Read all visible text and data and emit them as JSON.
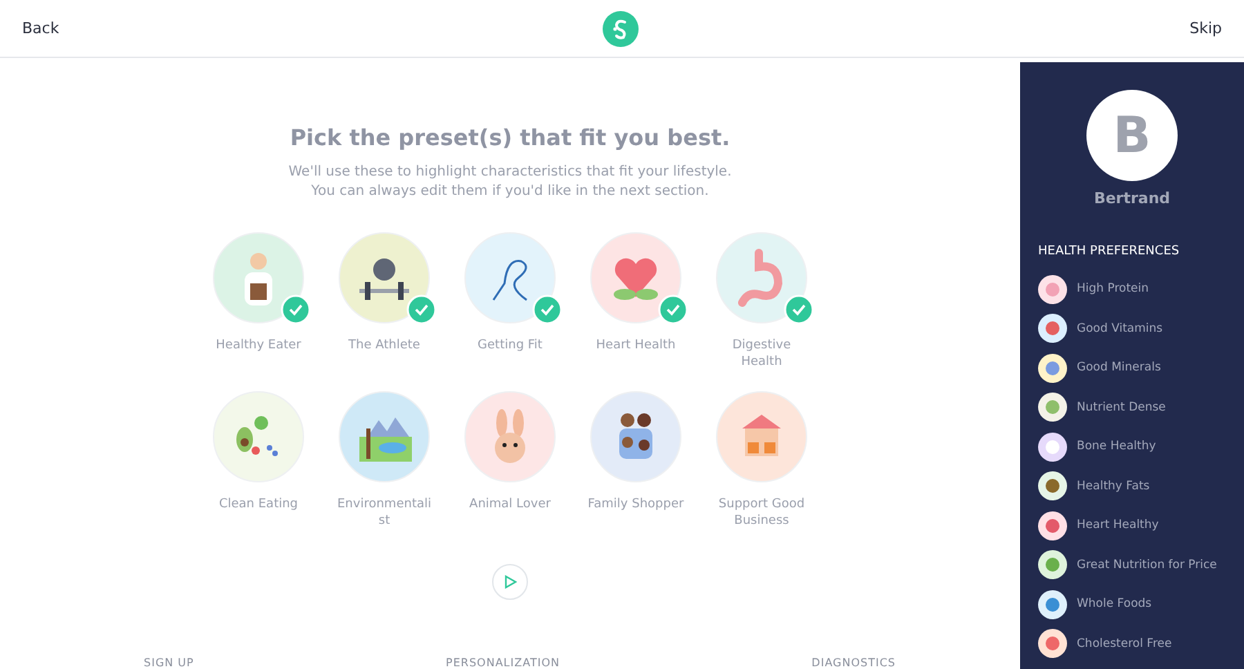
{
  "header": {
    "back": "Back",
    "skip": "Skip"
  },
  "title": "Pick the preset(s) that fit you best.",
  "subtitle": "We'll use these to highlight characteristics that fit your lifestyle. You can always edit them if you'd like in the next section.",
  "presets": [
    {
      "label": "Healthy Eater",
      "selected": true
    },
    {
      "label": "The Athlete",
      "selected": true
    },
    {
      "label": "Getting Fit",
      "selected": true
    },
    {
      "label": "Heart Health",
      "selected": true
    },
    {
      "label": "Digestive Health",
      "selected": true
    },
    {
      "label": "Clean Eating",
      "selected": false
    },
    {
      "label": "Environmentali st",
      "selected": false
    },
    {
      "label": "Animal Lover",
      "selected": false
    },
    {
      "label": "Family Shopper",
      "selected": false
    },
    {
      "label": "Support Good Business",
      "selected": false
    }
  ],
  "steps": [
    "SIGN UP",
    "PERSONALIZATION",
    "DIAGNOSTICS"
  ],
  "profile": {
    "initial": "B",
    "name": "Bertrand"
  },
  "preferences_title": "HEALTH PREFERENCES",
  "preferences": [
    "High Protein",
    "Good Vitamins",
    "Good Minerals",
    "Nutrient Dense",
    "Bone Healthy",
    "Healthy Fats",
    "Heart Healthy",
    "Great Nutrition for Price",
    "Whole Foods",
    "Cholesterol Free"
  ]
}
